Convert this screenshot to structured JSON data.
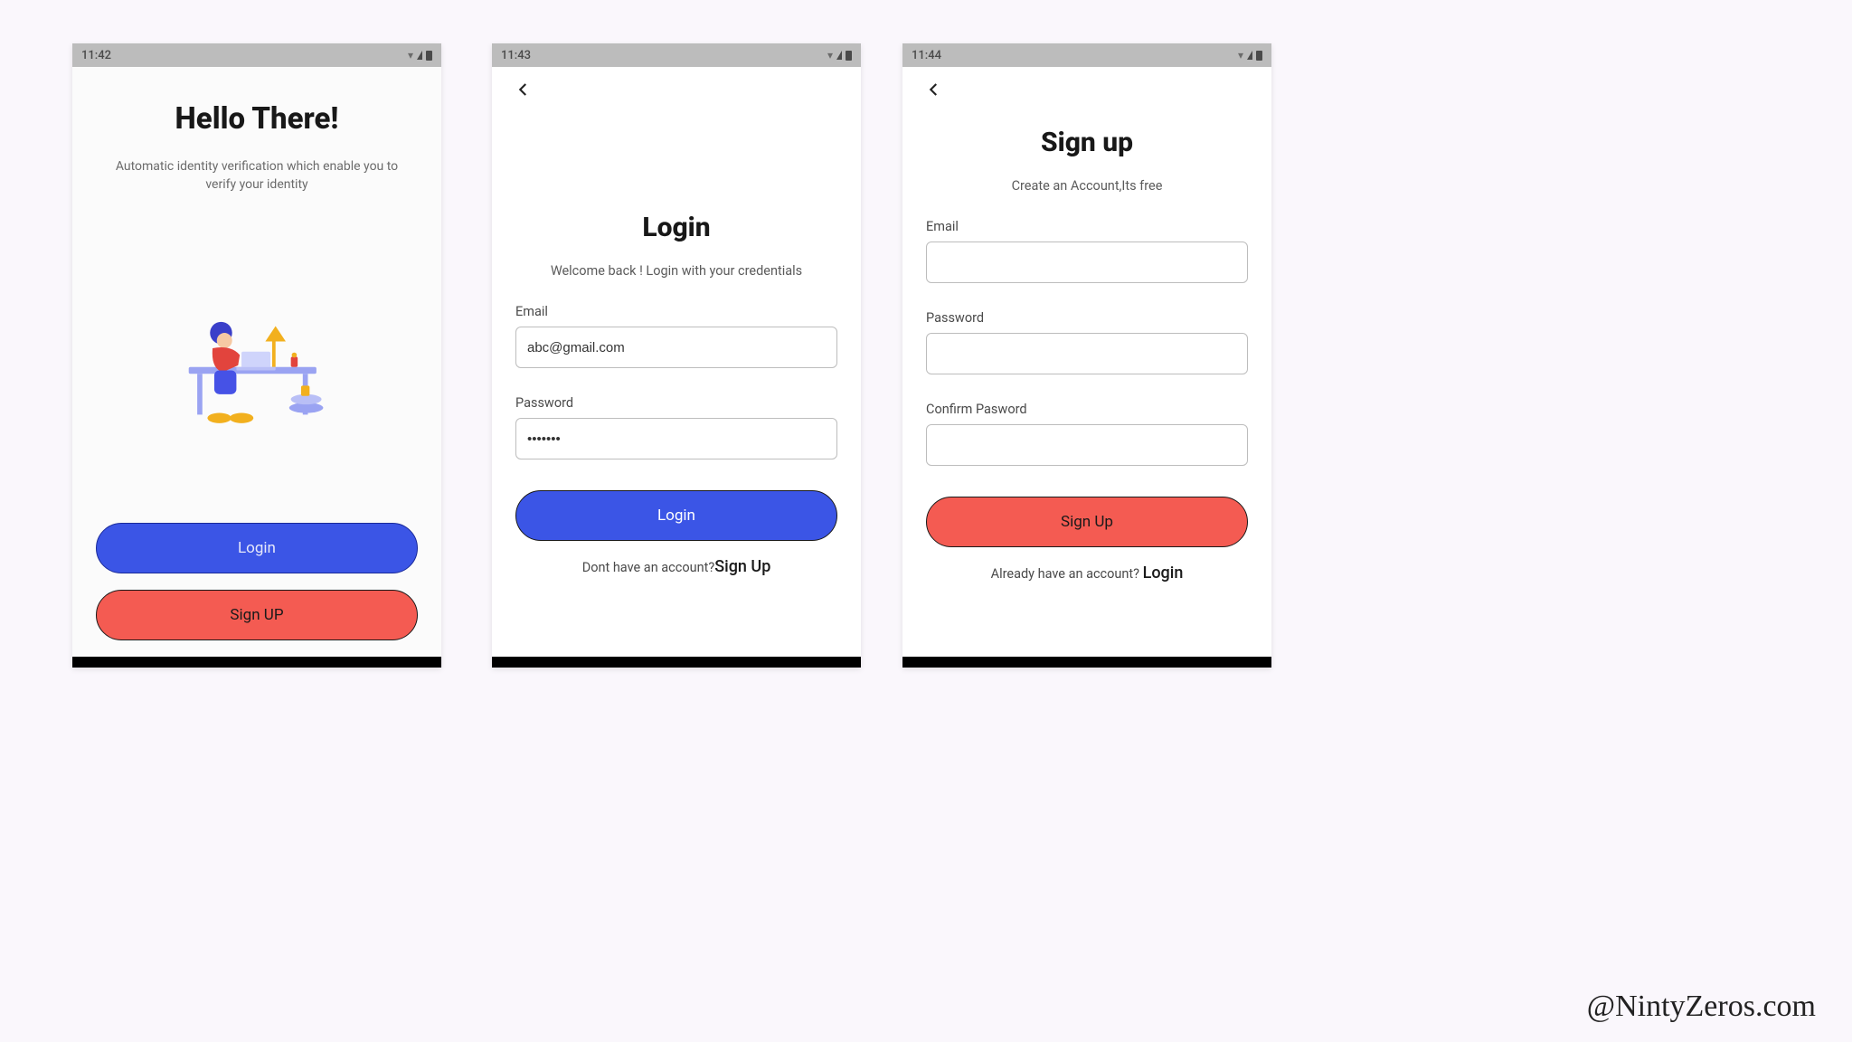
{
  "watermark": "@NintyZeros.com",
  "colors": {
    "blue": "#3b55e6",
    "red": "#f45b52"
  },
  "screen1": {
    "status_time": "11:42",
    "title": "Hello There!",
    "subtitle": "Automatic identity verification which enable you to verify your identity",
    "login_btn": "Login",
    "signup_btn": "Sign UP"
  },
  "screen2": {
    "status_time": "11:43",
    "title": "Login",
    "subtitle": "Welcome back ! Login with your credentials",
    "email_label": "Email",
    "email_value": "abc@gmail.com",
    "password_label": "Password",
    "password_value": "•••••••",
    "submit": "Login",
    "footer_text": "Dont have an account?",
    "footer_link": "Sign Up"
  },
  "screen3": {
    "status_time": "11:44",
    "title": "Sign up",
    "subtitle": "Create an Account,Its free",
    "email_label": "Email",
    "email_value": "",
    "password_label": "Password",
    "password_value": "",
    "confirm_label": "Confirm Pasword",
    "confirm_value": "",
    "submit": "Sign Up",
    "footer_text": "Already have an account? ",
    "footer_link": "Login"
  }
}
